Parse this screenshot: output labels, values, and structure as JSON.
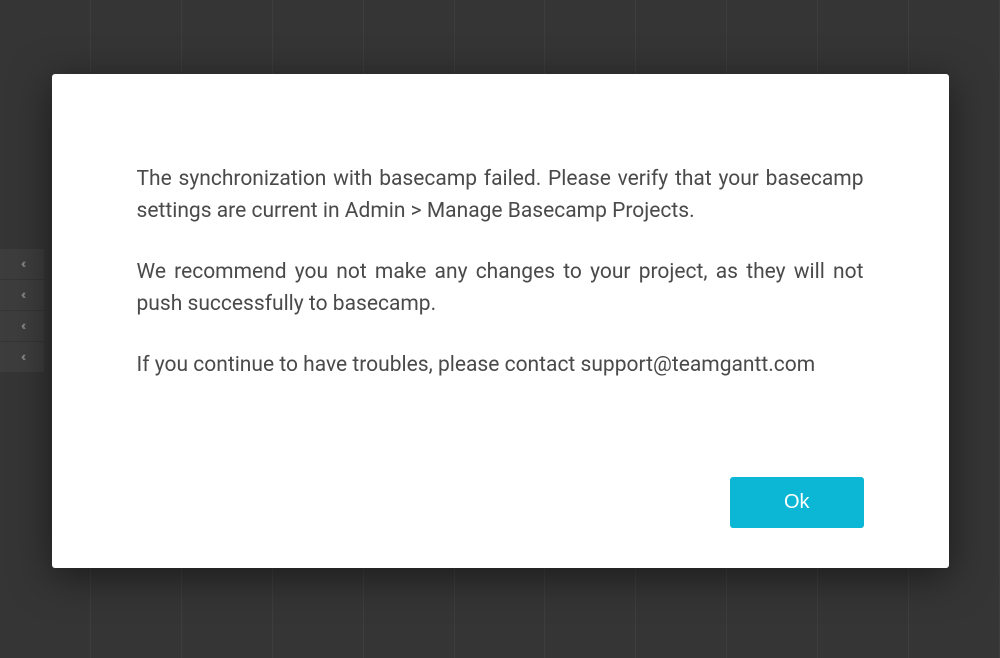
{
  "dialog": {
    "paragraph1": "The synchronization with basecamp failed. Please verify that your basecamp settings are current in Admin > Manage Basecamp Projects.",
    "paragraph2": "We recommend you not make any changes to your project, as they will not push successfully to basecamp.",
    "paragraph3": "If you continue to have troubles, please contact support@teamgantt.com",
    "ok_label": "Ok"
  },
  "sidebar": {
    "chevron_glyph": "‹‹"
  },
  "colors": {
    "accent": "#0bb7d4",
    "background": "#353535",
    "text": "#4a4a4a"
  }
}
